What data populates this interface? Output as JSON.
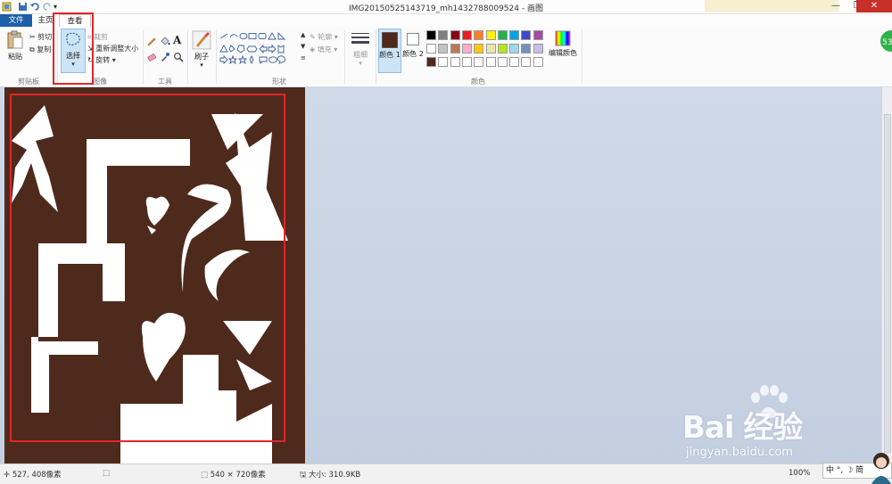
{
  "window": {
    "title": "IMG20150525143719_mh1432788009524 - 画图",
    "minimize": "—",
    "restore": "❐",
    "close": "✕"
  },
  "tabs": {
    "file": "文件",
    "home": "主页",
    "view": "查看"
  },
  "ribbon": {
    "clipboard": {
      "paste": "粘贴",
      "cut": "剪切",
      "copy": "复制",
      "label": "剪贴板"
    },
    "image": {
      "select": "选择",
      "crop": "裁剪",
      "resize": "重新调整大小",
      "rotate": "旋转",
      "label": "图像"
    },
    "tools": {
      "label": "工具"
    },
    "brushes": {
      "label": "刷子"
    },
    "shapes": {
      "outline": "轮廓",
      "fill": "填充",
      "label": "形状"
    },
    "size": {
      "label": "粗细"
    },
    "colors": {
      "color1": "颜色 1",
      "color2": "颜色 2",
      "edit": "编辑颜色",
      "label": "颜色",
      "color1_value": "#4e2a1c",
      "color2_value": "#ffffff",
      "palette_row1": [
        "#000000",
        "#7f7f7f",
        "#880015",
        "#ed1c24",
        "#ff7f27",
        "#fff200",
        "#22b14c",
        "#00a2e8",
        "#3f48cc",
        "#a349a4"
      ],
      "palette_row2": [
        "#ffffff",
        "#c3c3c3",
        "#b97a57",
        "#ffaec9",
        "#ffc90e",
        "#efe4b0",
        "#b5e61d",
        "#99d9ea",
        "#7092be",
        "#c8bfe7"
      ],
      "palette_row3": [
        "#4e2a1c",
        "#ffffff",
        "#ffffff",
        "#ffffff",
        "#ffffff",
        "#ffffff",
        "#ffffff",
        "#ffffff",
        "#ffffff",
        "#ffffff"
      ]
    }
  },
  "status": {
    "cursor": "527, 408像素",
    "dimensions": "540 × 720像素",
    "filesize": "大小: 310.9KB",
    "zoom": "100%"
  },
  "watermark": {
    "brand": "Bai 经验",
    "url": "jingyan.baidu.com"
  },
  "ime": {
    "text": "中 °, ☽ 简"
  },
  "canvas_colors": {
    "background": "#4e2a1c",
    "foreground": "#ffffff"
  }
}
